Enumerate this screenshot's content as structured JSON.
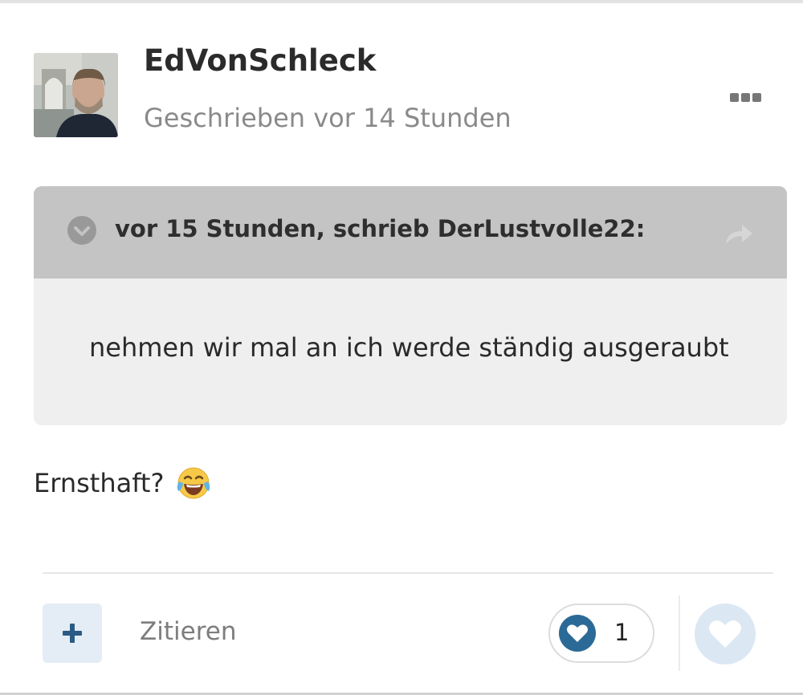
{
  "post": {
    "author": "EdVonSchleck",
    "date": "Geschrieben vor 14 Stunden",
    "text": "Ernsthaft?",
    "emoji_icon": "face-with-tears-of-joy-icon"
  },
  "quote": {
    "citation": "vor 15 Stunden, schrieb DerLustvolle22:",
    "text": "nehmen wir mal an ich werde ständig ausgeraubt"
  },
  "footer": {
    "quote_label": "Zitieren",
    "reaction_count": "1"
  },
  "colors": {
    "accent": "#2b6a97",
    "quote_header_bg": "#c4c4c4",
    "quote_body_bg": "#efefef",
    "add_button_bg": "#e4edf5",
    "react_button_bg": "#dbe8f3"
  }
}
